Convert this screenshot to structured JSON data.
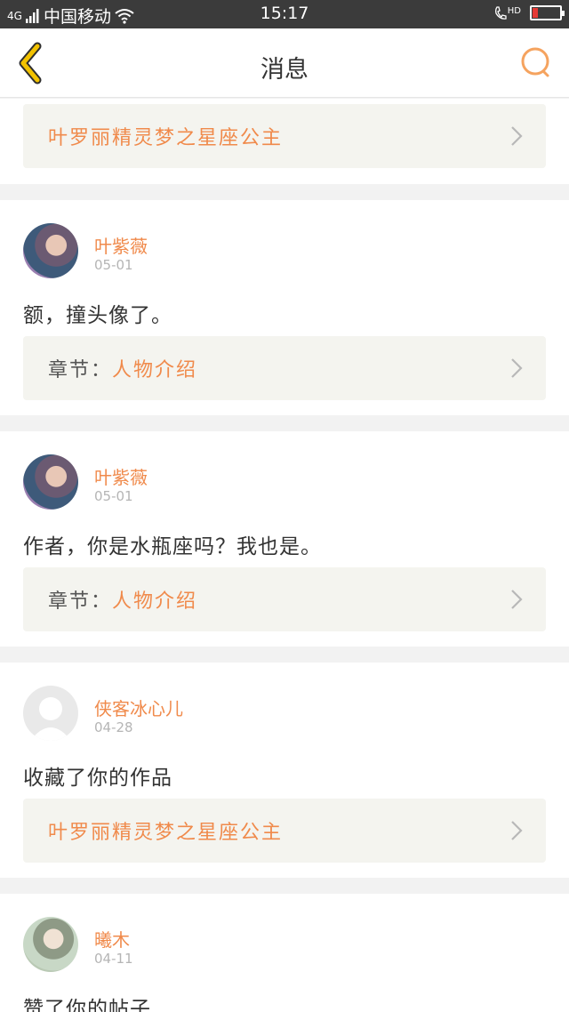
{
  "status_bar": {
    "signal": "4G",
    "carrier": "中国移动",
    "time": "15:17",
    "hd": "HD"
  },
  "header": {
    "title": "消息"
  },
  "colors": {
    "accent": "#f08a4b",
    "back_icon": "#f2c200"
  },
  "icons": {
    "back": "chevron-left-icon",
    "search": "search-icon",
    "wifi": "wifi-icon",
    "phone": "phone-icon",
    "battery": "battery-icon"
  },
  "top_link": {
    "title": "叶罗丽精灵梦之星座公主"
  },
  "messages": [
    {
      "user": "叶紫薇",
      "date": "05-01",
      "text": "额，撞头像了。",
      "link_label": "章节：",
      "link_title": "人物介绍"
    },
    {
      "user": "叶紫薇",
      "date": "05-01",
      "text": "作者，你是水瓶座吗？我也是。",
      "link_label": "章节：",
      "link_title": "人物介绍"
    },
    {
      "user": "侠客冰心儿",
      "date": "04-28",
      "text": "收藏了你的作品",
      "link_label": "",
      "link_title": "叶罗丽精灵梦之星座公主"
    },
    {
      "user": "曦木",
      "date": "04-11",
      "text": "赞了你的帖子",
      "link_label": "",
      "link_title": ""
    }
  ]
}
